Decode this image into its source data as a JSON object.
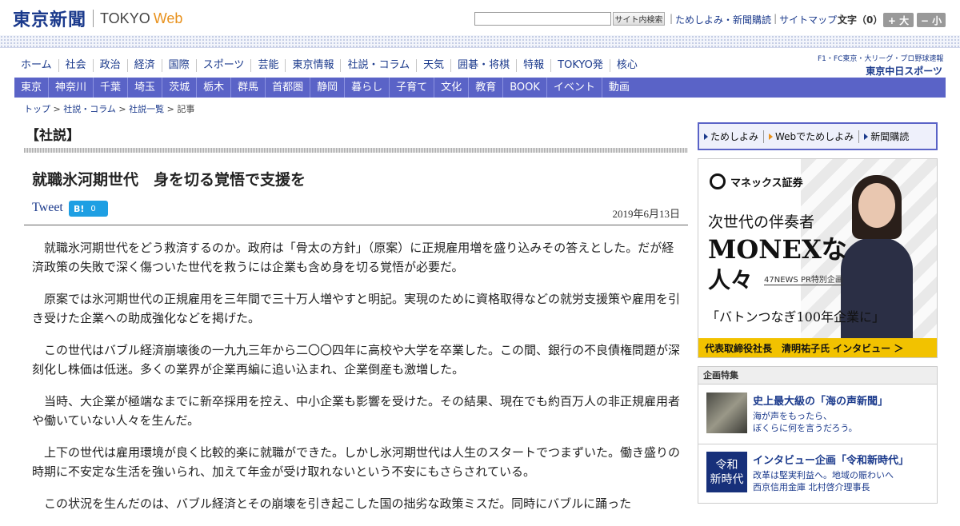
{
  "header": {
    "logo_kanji": "東京新聞",
    "logo_tokyo": "TOKYO",
    "logo_web": "Web",
    "search_placeholder": "",
    "search_button": "サイト内検索",
    "links": [
      "ためしよみ・新聞購読",
      "サイトマップ"
    ],
    "fontsize_label": "文字（0）",
    "fontsize_up": "+ 大",
    "fontsize_down": "− 小"
  },
  "mainnav": [
    "ホーム",
    "社会",
    "政治",
    "経済",
    "国際",
    "スポーツ",
    "芸能",
    "東京情報",
    "社説・コラム",
    "天気",
    "囲碁・将棋",
    "特報",
    "TOKYO発",
    "核心"
  ],
  "chunichi": {
    "line1": "F1・FC東京・大リーグ・プロ野球速報",
    "line2": "東京中日スポーツ"
  },
  "subnav": [
    "東京",
    "神奈川",
    "千葉",
    "埼玉",
    "茨城",
    "栃木",
    "群馬",
    "首都圏",
    "静岡",
    "暮らし",
    "子育て",
    "文化",
    "教育",
    "BOOK",
    "イベント",
    "動画"
  ],
  "breadcrumb": {
    "items": [
      "トップ",
      "社説・コラム",
      "社説一覧"
    ],
    "current": "記事"
  },
  "section_title": "【社説】",
  "article": {
    "title": "就職氷河期世代　身を切る覚悟で支援を",
    "tweet": "Tweet",
    "hatena_label": "B!",
    "hatena_count": "0",
    "date": "2019年6月13日",
    "paragraphs": [
      "就職氷河期世代をどう救済するのか。政府は「骨太の方針」（原案）に正規雇用増を盛り込みその答えとした。だが経済政策の失敗で深く傷ついた世代を救うには企業も含め身を切る覚悟が必要だ。",
      "原案では氷河期世代の正規雇用を三年間で三十万人増やすと明記。実現のために資格取得などの就労支援策や雇用を引き受けた企業への助成強化などを掲げた。",
      "この世代はバブル経済崩壊後の一九九三年から二〇〇四年に高校や大学を卒業した。この間、銀行の不良債権問題が深刻化し株価は低迷。多くの業界が企業再編に追い込まれ、企業倒産も激増した。",
      "当時、大企業が極端なまでに新卒採用を控え、中小企業も影響を受けた。その結果、現在でも約百万人の非正規雇用者や働いていない人々を生んだ。",
      "上下の世代は雇用環境が良く比較的楽に就職ができた。しかし氷河期世代は人生のスタートでつまずいた。働き盛りの時期に不安定な生活を強いられ、加えて年金が受け取れないという不安にもさらされている。",
      "この状況を生んだのは、バブル経済とその崩壊を引き起こした国の拙劣な政策ミスだ。同時にバブルに踊った"
    ]
  },
  "subscribe": [
    "ためしよみ",
    "Webでためしよみ",
    "新聞購読"
  ],
  "ad": {
    "brand": "マネックス証券",
    "line1": "次世代の伴奏者",
    "line2": "MONEXな",
    "line3": "人々",
    "pr": "47NEWS PR特別企画",
    "quote": "「バトンつなぎ100年企業に」",
    "bar": "代表取締役社長　清明祐子氏 インタビュー ＞"
  },
  "feature": {
    "heading": "企画特集",
    "items": [
      {
        "title": "史上最大級の「海の声新聞」",
        "desc1": "海が声をもったら、",
        "desc2": "ぼくらに何を言うだろう。",
        "thumb_text": ""
      },
      {
        "title": "インタビュー企画「令和新時代」",
        "desc1": "改革は堅実利益へ。地域の賑わいへ",
        "desc2": "西京信用金庫 北村啓介理事長",
        "thumb_line1": "令和",
        "thumb_line2": "新時代"
      }
    ]
  }
}
